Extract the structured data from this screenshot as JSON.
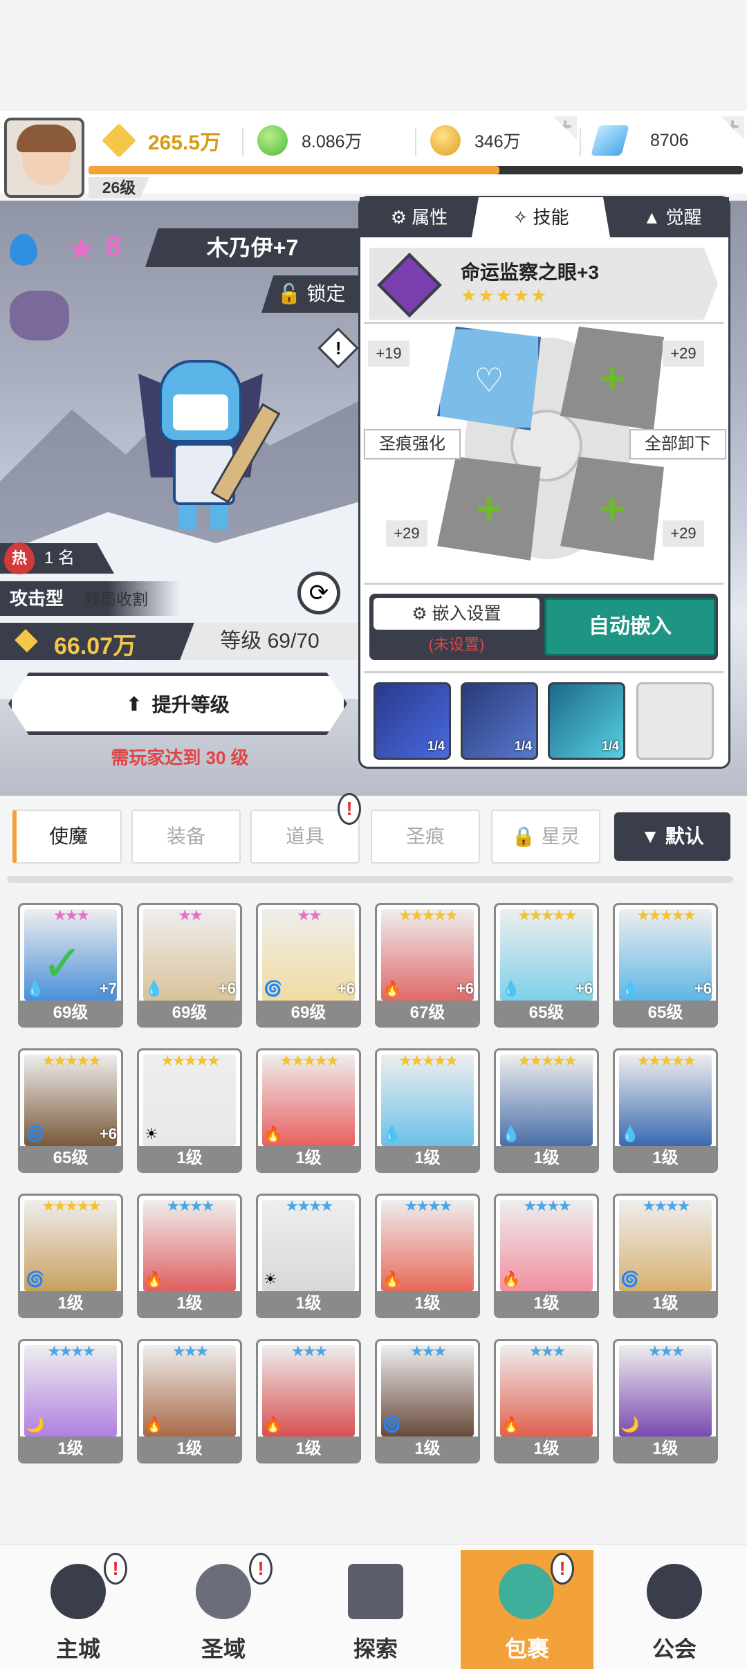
{
  "resources": {
    "power": "265.5万",
    "green": "8.086万",
    "gold": "346万",
    "gem": "8706",
    "player_level": "26级"
  },
  "hero": {
    "star_count": "8",
    "name": "木乃伊+7",
    "lock_label": "锁定",
    "rank_label": "1 名",
    "type_label": "攻击型",
    "role_label": "残局收割",
    "power": "66.07万",
    "level_text": "等级 69/70",
    "upgrade_label": "提升等级",
    "upgrade_req": "需玩家达到 30 级",
    "hot_label": "热"
  },
  "panel": {
    "tabs": [
      "属性",
      "技能",
      "觉醒"
    ],
    "skill_name": "命运监察之眼+3",
    "stars": "★★★★★",
    "left_top": "+19",
    "right_top": "+29",
    "left_bottom": "+29",
    "right_bottom": "+29",
    "strengthen": "圣痕强化",
    "unload_all": "全部卸下",
    "embed_settings": "嵌入设置",
    "embed_status": "(未设置)",
    "auto_embed": "自动嵌入",
    "runes": [
      {
        "count": "1/4"
      },
      {
        "count": "1/4"
      },
      {
        "count": "1/4"
      }
    ]
  },
  "filters": {
    "items": [
      "使魔",
      "装备",
      "道具",
      "圣痕",
      "星灵"
    ],
    "sort": "默认"
  },
  "cards": [
    {
      "stars": "★★★",
      "lv": "69级",
      "plus": "+7",
      "el": "💧",
      "c": "#4a8fd8",
      "sc": "#e86fc8"
    },
    {
      "stars": "★★",
      "lv": "69级",
      "plus": "+6",
      "el": "💧",
      "c": "#d9c29a",
      "sc": "#e86fc8"
    },
    {
      "stars": "★★",
      "lv": "69级",
      "plus": "+6",
      "el": "🌀",
      "c": "#f0dba0",
      "sc": "#e86fc8"
    },
    {
      "stars": "★★★★★",
      "lv": "67级",
      "plus": "+6",
      "el": "🔥",
      "c": "#e06a6a",
      "sc": "#f2c230"
    },
    {
      "stars": "★★★★★",
      "lv": "65级",
      "plus": "+6",
      "el": "💧",
      "c": "#7fd0ea",
      "sc": "#f2c230"
    },
    {
      "stars": "★★★★★",
      "lv": "65级",
      "plus": "+6",
      "el": "💧",
      "c": "#5fb6e6",
      "sc": "#f2c230"
    },
    {
      "stars": "★★★★★",
      "lv": "65级",
      "plus": "+6",
      "el": "🌀",
      "c": "#7a5a3a",
      "sc": "#f2c230"
    },
    {
      "stars": "★★★★★",
      "lv": "1级",
      "plus": "",
      "el": "☀",
      "c": "#e8e8e8",
      "sc": "#f2c230"
    },
    {
      "stars": "★★★★★",
      "lv": "1级",
      "plus": "",
      "el": "🔥",
      "c": "#e86060",
      "sc": "#f2c230"
    },
    {
      "stars": "★★★★★",
      "lv": "1级",
      "plus": "",
      "el": "💧",
      "c": "#6cc0e8",
      "sc": "#f2c230"
    },
    {
      "stars": "★★★★★",
      "lv": "1级",
      "plus": "",
      "el": "💧",
      "c": "#4a6fa8",
      "sc": "#f2c230"
    },
    {
      "stars": "★★★★★",
      "lv": "1级",
      "plus": "",
      "el": "💧",
      "c": "#3a6ab0",
      "sc": "#f2c230"
    },
    {
      "stars": "★★★★★",
      "lv": "1级",
      "plus": "",
      "el": "🌀",
      "c": "#c8a060",
      "sc": "#f2c230"
    },
    {
      "stars": "★★★★",
      "lv": "1级",
      "plus": "",
      "el": "🔥",
      "c": "#e06060",
      "sc": "#4aa6e6"
    },
    {
      "stars": "★★★★",
      "lv": "1级",
      "plus": "",
      "el": "☀",
      "c": "#d8d8d8",
      "sc": "#4aa6e6"
    },
    {
      "stars": "★★★★",
      "lv": "1级",
      "plus": "",
      "el": "🔥",
      "c": "#e86a5a",
      "sc": "#4aa6e6"
    },
    {
      "stars": "★★★★",
      "lv": "1级",
      "plus": "",
      "el": "🔥",
      "c": "#f090a0",
      "sc": "#4aa6e6"
    },
    {
      "stars": "★★★★",
      "lv": "1级",
      "plus": "",
      "el": "🌀",
      "c": "#d8b070",
      "sc": "#4aa6e6"
    },
    {
      "stars": "★★★★",
      "lv": "1级",
      "plus": "",
      "el": "🌙",
      "c": "#b080e0",
      "sc": "#4aa6e6"
    },
    {
      "stars": "★★★",
      "lv": "1级",
      "plus": "",
      "el": "🔥",
      "c": "#a86a4a",
      "sc": "#4aa6e6"
    },
    {
      "stars": "★★★",
      "lv": "1级",
      "plus": "",
      "el": "🔥",
      "c": "#d85050",
      "sc": "#4aa6e6"
    },
    {
      "stars": "★★★",
      "lv": "1级",
      "plus": "",
      "el": "🌀",
      "c": "#6a4a3a",
      "sc": "#4aa6e6"
    },
    {
      "stars": "★★★",
      "lv": "1级",
      "plus": "",
      "el": "🔥",
      "c": "#e06050",
      "sc": "#4aa6e6"
    },
    {
      "stars": "★★★",
      "lv": "1级",
      "plus": "",
      "el": "🌙",
      "c": "#7a4ab0",
      "sc": "#4aa6e6"
    }
  ],
  "nav": {
    "items": [
      "主城",
      "圣域",
      "探索",
      "包裹",
      "公会"
    ]
  }
}
